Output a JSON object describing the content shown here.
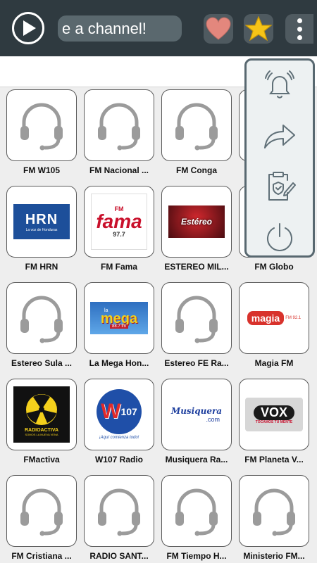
{
  "header": {
    "search_text": "e a channel!",
    "icons": {
      "play": "play-icon",
      "favorites": "heart-icon",
      "rate": "star-icon",
      "more": "more-vertical-icon"
    }
  },
  "stations": [
    {
      "name": "FM W105",
      "logo": "headset-icon"
    },
    {
      "name": "FM Nacional ...",
      "logo": "headset-icon"
    },
    {
      "name": "FM Conga",
      "logo": "headset-icon"
    },
    {
      "name": "",
      "logo": "headset-icon"
    },
    {
      "name": "FM HRN",
      "logo": "hrn-logo",
      "logo_text": "HRN",
      "logo_sub": "La voz de Honduras"
    },
    {
      "name": "FM Fama",
      "logo": "fama-logo",
      "logo_text": "fama",
      "logo_small": "FM",
      "logo_sub": "97.7"
    },
    {
      "name": "ESTEREO MIL...",
      "logo": "estereo-mil-logo",
      "logo_text": "Estéreo"
    },
    {
      "name": "FM Globo",
      "logo": "headset-icon"
    },
    {
      "name": "Estereo Sula ...",
      "logo": "headset-icon"
    },
    {
      "name": "La Mega Hon...",
      "logo": "mega-logo",
      "logo_text": "mega",
      "logo_small": "la",
      "logo_sub": "88.7 fm"
    },
    {
      "name": "Estereo FE Ra...",
      "logo": "headset-icon"
    },
    {
      "name": "Magia FM",
      "logo": "magia-logo",
      "logo_text": "magia",
      "logo_sub": "FM 92.1"
    },
    {
      "name": "FMactiva",
      "logo": "radioactiva-logo",
      "logo_text": "RADIOACTIVA",
      "logo_sub": "SOMOS LA NUEVA VENA"
    },
    {
      "name": "W107 Radio",
      "logo": "w107-logo",
      "logo_text": "W",
      "logo_small": "107",
      "logo_sub": "¡Aquí comienza todo!"
    },
    {
      "name": "Musiquera Ra...",
      "logo": "musiquera-logo",
      "logo_text": "Musiquera",
      "logo_sub": ".com"
    },
    {
      "name": "FM Planeta V...",
      "logo": "vox-logo",
      "logo_text": "VOX",
      "logo_sub": "TOCAMOS TU MENTE"
    },
    {
      "name": "FM Cristiana ...",
      "logo": "headset-icon"
    },
    {
      "name": "RADIO SANT...",
      "logo": "headset-icon"
    },
    {
      "name": "FM Tiempo H...",
      "logo": "headset-icon"
    },
    {
      "name": "Ministerio FM...",
      "logo": "headset-icon"
    }
  ],
  "side_menu": {
    "items": [
      {
        "icon": "alarm-bell-icon"
      },
      {
        "icon": "share-icon"
      },
      {
        "icon": "policy-document-icon"
      },
      {
        "icon": "power-icon"
      }
    ]
  },
  "colors": {
    "topbar": "#2f3a40",
    "menu_border": "#586870",
    "star": "#f6c417",
    "heart": "#e3877d"
  }
}
